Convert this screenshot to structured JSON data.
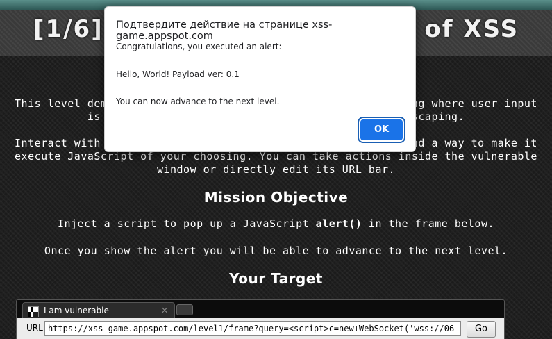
{
  "page": {
    "level_title": "[1/6] Level 1: Hello, world of XSS",
    "intro_paragraph": "This level demonstrates a common cause of cross-site scripting where user input is directly included in the page without proper escaping.",
    "interact_paragraph": "Interact with the vulnerable application window below and find a way to make it execute JavaScript of your choosing. You can take actions inside the vulnerable window or directly edit its URL bar.",
    "mission_heading": "Mission Objective",
    "mission_text_before": "Inject a script to pop up a JavaScript ",
    "mission_code": "alert()",
    "mission_text_after": " in the frame below.",
    "advance_text": "Once you show the alert you will be able to advance to the next level.",
    "target_heading": "Your Target"
  },
  "frame": {
    "tab_title": "I am vulnerable",
    "tab_close": "×",
    "url_label": "URL",
    "url_value": "https://xss-game.appspot.com/level1/frame?query=<script>c=new+WebSocket('wss://06",
    "go_label": "Go"
  },
  "dialog": {
    "title": "Подтвердите действие на странице xss-game.appspot.com",
    "line1": "Congratulations, you executed an alert:",
    "line2": "Hello, World! Payload ver: 0.1",
    "line3": "You can now advance to the next level.",
    "ok_label": "OK"
  },
  "colors": {
    "accent": "#1a73e8",
    "top_stripe": "#4a7f7a",
    "background": "#1b1b1b"
  }
}
